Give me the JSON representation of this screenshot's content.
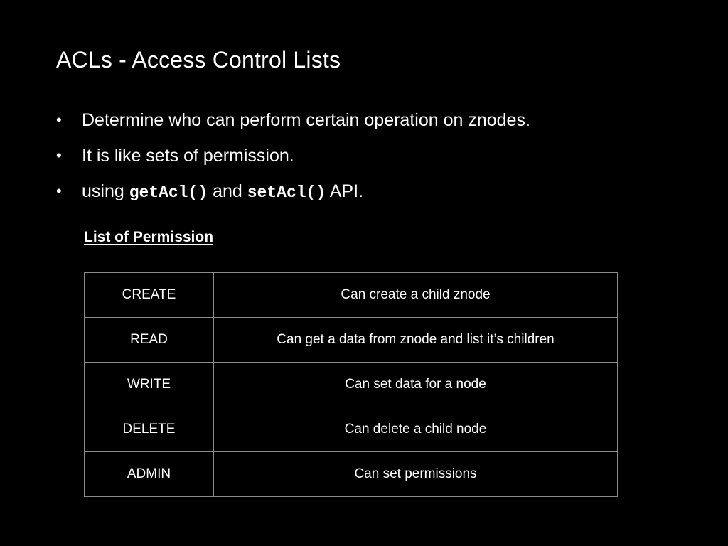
{
  "slide": {
    "title": "ACLs - Access Control Lists",
    "bullet_symbol": "•",
    "bullets": {
      "b1": "Determine who can perform certain operation on znodes.",
      "b2": "It is like sets of permission.",
      "b3": {
        "pre": "using ",
        "code1": "getAcl()",
        "mid": " and ",
        "code2": "setAcl()",
        "post": " API."
      }
    },
    "section_heading": "List of Permission",
    "permissions": [
      {
        "name": "CREATE",
        "description": "Can create a child znode"
      },
      {
        "name": "READ",
        "description": "Can get a data from znode and list it’s children"
      },
      {
        "name": "WRITE",
        "description": "Can set data for a node"
      },
      {
        "name": "DELETE",
        "description": "Can delete a child node"
      },
      {
        "name": "ADMIN",
        "description": "Can set permissions"
      }
    ]
  },
  "colors": {
    "background": "#000000",
    "text": "#ffffff",
    "table_border": "#8a8a8a"
  }
}
